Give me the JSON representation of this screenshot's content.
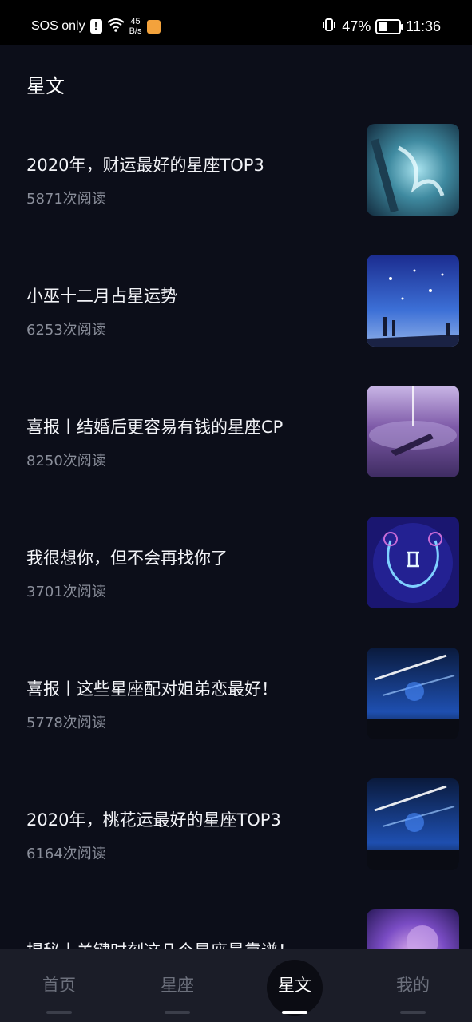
{
  "status_bar": {
    "carrier": "SOS only",
    "net_speed_value": "45",
    "net_speed_unit": "B/s",
    "battery": "47%",
    "time": "11:36",
    "icons": [
      "alert-icon",
      "wifi-icon",
      "app-notification-icon",
      "vibrate-icon",
      "battery-icon"
    ]
  },
  "page": {
    "title": "星文"
  },
  "articles": [
    {
      "title": "2020年，财运最好的星座TOP3",
      "reads": "5871次阅读",
      "thumbnail": "ice-dragon-art"
    },
    {
      "title": "小巫十二月占星运势",
      "reads": "6253次阅读",
      "thumbnail": "starry-night-figures"
    },
    {
      "title": "喜报丨结婚后更容易有钱的星座CP",
      "reads": "8250次阅读",
      "thumbnail": "boat-on-lake"
    },
    {
      "title": "我很想你，但不会再找你了",
      "reads": "3701次阅读",
      "thumbnail": "gemini-sign"
    },
    {
      "title": "喜报丨这些星座配对姐弟恋最好！",
      "reads": "5778次阅读",
      "thumbnail": "meteor-shower"
    },
    {
      "title": "2020年，桃花运最好的星座TOP3",
      "reads": "6164次阅读",
      "thumbnail": "meteor-shower"
    },
    {
      "title": "揭秘丨关键时刻这几个星座最靠谱！",
      "reads": "",
      "thumbnail": "purple-nebula"
    }
  ],
  "bottom_nav": {
    "tabs": [
      {
        "label": "首页",
        "active": false
      },
      {
        "label": "星座",
        "active": false
      },
      {
        "label": "星文",
        "active": true
      },
      {
        "label": "我的",
        "active": false
      }
    ]
  },
  "colors": {
    "background": "#0c0e19",
    "nav_background": "#1b1d28",
    "text_secondary": "#8a8e9a",
    "nav_inactive": "#6c707c"
  }
}
